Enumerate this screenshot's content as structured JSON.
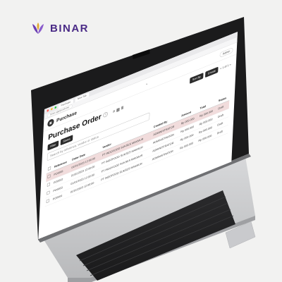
{
  "brand": {
    "name": "BINAR",
    "accent": "#4a2a86",
    "logo_colors": [
      "#6b3fb3",
      "#e0a830"
    ]
  },
  "browser": {
    "tab_title": "Purchase",
    "new_tab_label": "New Tab",
    "url": "binar.app/purchase"
  },
  "app": {
    "title": "Purchase",
    "user_label": "Admin",
    "bell_icon": "bell-icon"
  },
  "page": {
    "title": "Purchase Order",
    "search_placeholder": "Search by reference, vendor or status",
    "filter_button": "Filter",
    "status_button": "Status",
    "sort_button": "Sort By",
    "create_button": "Create",
    "pager": "< 1 of 1 >",
    "view_label": "≡ ▦ Ⅲ"
  },
  "table": {
    "columns": [
      "",
      "Reference",
      "Order Date",
      "Vendor",
      "Created By",
      "Amount",
      "Total",
      "Status"
    ],
    "rows": [
      [
        "PO0001",
        "01/01/2023 12:00:00",
        "PT INDOFOOD SUKSES MAKMUR",
        "ADMINISTRATOR",
        "Rp 000.000",
        "Rp 000.000",
        "Draft"
      ],
      [
        "PO0002",
        "01/01/2023 12:00:00",
        "PT INDOFOOD SUKSES MAKMUR",
        "ADMINISTRATOR",
        "Rp 000.000",
        "Rp 000.000",
        "Draft"
      ],
      [
        "PO0003",
        "01/01/2023 12:00:00",
        "PT INDOFOOD SUKSES MAKMUR",
        "ADMINISTRATOR",
        "Rp 000.000",
        "Rp 000.000",
        "Draft"
      ],
      [
        "PO0004",
        "01/01/2023 12:00:00",
        "PT INDOFOOD SUKSES MAKMUR",
        "ADMINISTRATOR",
        "Rp 000.000",
        "Rp 000.000",
        "Draft"
      ]
    ],
    "highlight_row": 0
  }
}
